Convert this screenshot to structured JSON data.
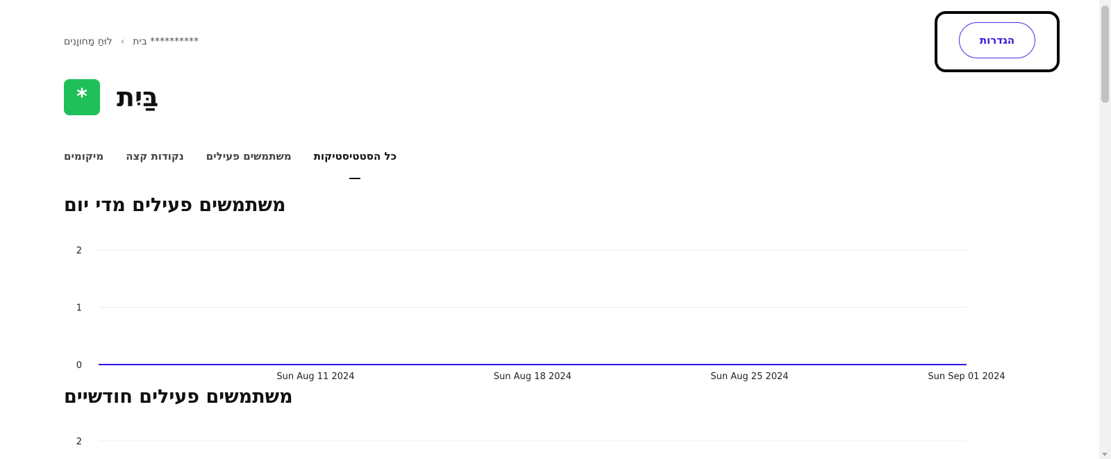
{
  "breadcrumb": {
    "root_label": "לוּחַ מַחווָנִים",
    "separator": "‹",
    "current_label": "בית **********"
  },
  "settings": {
    "label": "הגדרות",
    "accent_color": "#3b19d6"
  },
  "site": {
    "avatar_glyph": "*",
    "avatar_color": "#1fbf5a",
    "title": "בַּיִת"
  },
  "tabs": [
    {
      "label": "כל הסטטיסטיקות",
      "active": true
    },
    {
      "label": "משתמשים פעילים",
      "active": false
    },
    {
      "label": "נקודות קצה",
      "active": false
    },
    {
      "label": "מיקומים",
      "active": false
    }
  ],
  "sections": {
    "daily_title": "משתמשים פעילים מדי יום",
    "monthly_title": "משתמשים פעילים חודשיים"
  },
  "chart_data": [
    {
      "type": "line",
      "title": "משתמשים פעילים מדי יום",
      "xlabel": "",
      "ylabel": "",
      "ylim": [
        0,
        2
      ],
      "yticks": [
        0,
        1,
        2
      ],
      "xlim": [
        "2024-08-04",
        "2024-09-01"
      ],
      "xticks": [
        {
          "date": "2024-08-11",
          "label": "Sun Aug 11 2024"
        },
        {
          "date": "2024-08-18",
          "label": "Sun Aug 18 2024"
        },
        {
          "date": "2024-08-25",
          "label": "Sun Aug 25 2024"
        },
        {
          "date": "2024-09-01",
          "label": "Sun Sep 01 2024"
        }
      ],
      "grid": true,
      "series": [
        {
          "color": "#2b14ee",
          "x": [
            "2024-08-04",
            "2024-09-01"
          ],
          "y": [
            0,
            0
          ]
        }
      ]
    },
    {
      "type": "line",
      "title": "משתמשים פעילים חודשיים",
      "xlabel": "",
      "ylabel": "",
      "ylim": [
        0,
        2
      ],
      "yticks": [
        2
      ],
      "grid": true,
      "series": []
    }
  ]
}
